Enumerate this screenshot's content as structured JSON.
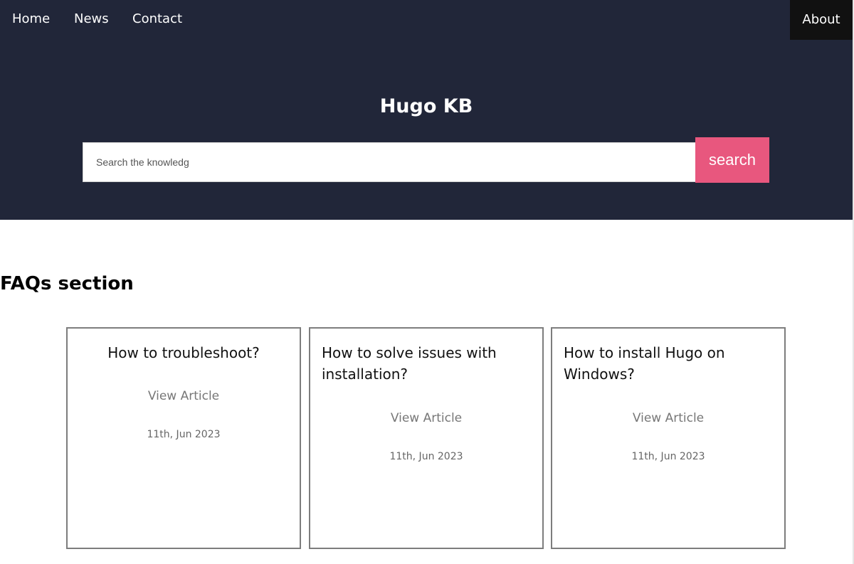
{
  "nav": {
    "home": "Home",
    "news": "News",
    "contact": "Contact",
    "about": "About"
  },
  "hero": {
    "title": "Hugo KB",
    "search_placeholder": "Search the knowledg",
    "search_button": "search"
  },
  "faqs": {
    "heading": "FAQs section",
    "cards": [
      {
        "title": "How to troubleshoot?",
        "link": "View Article",
        "date": "11th, Jun 2023"
      },
      {
        "title": "How to solve issues with installation?",
        "link": "View Article",
        "date": "11th, Jun 2023"
      },
      {
        "title": "How to install Hugo on Windows?",
        "link": "View Article",
        "date": "11th, Jun 2023"
      }
    ]
  },
  "colors": {
    "header_bg": "#212639",
    "accent": "#e8577e",
    "about_bg": "#111111"
  }
}
